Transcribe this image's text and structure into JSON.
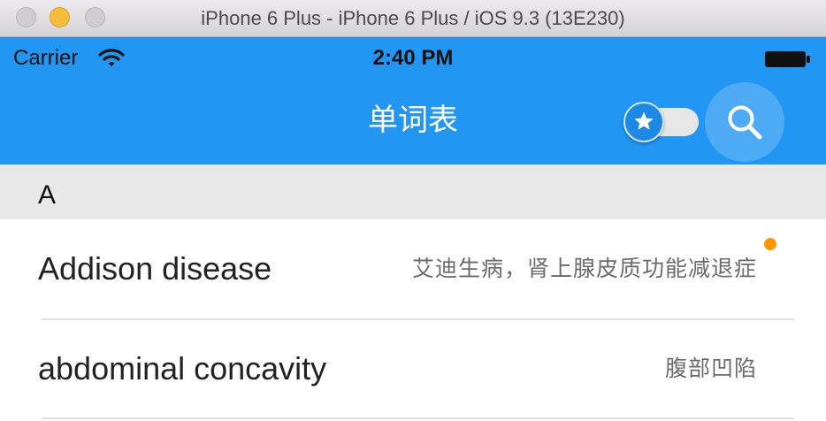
{
  "window": {
    "title": "iPhone 6 Plus - iPhone 6 Plus / iOS 9.3 (13E230)",
    "controls": [
      "close-button",
      "minimize-button",
      "zoom-button"
    ]
  },
  "status_bar": {
    "carrier": "Carrier",
    "time": "2:40 PM",
    "wifi_icon": "wifi-icon",
    "battery_icon": "battery-icon"
  },
  "nav": {
    "title": "单词表",
    "favorites_toggle": {
      "icon": "star-icon",
      "on": false
    },
    "search_icon": "search-icon"
  },
  "colors": {
    "primary": "#2196F3",
    "badge": "#FF9800",
    "section_bg": "#E8E8E8"
  },
  "sections": [
    {
      "letter": "A",
      "rows": [
        {
          "word": "Addison disease",
          "meaning": "艾迪生病，肾上腺皮质功能减退症",
          "unread_dot": true
        },
        {
          "word": "abdominal concavity",
          "meaning": "腹部凹陷",
          "unread_dot": false
        }
      ]
    }
  ]
}
